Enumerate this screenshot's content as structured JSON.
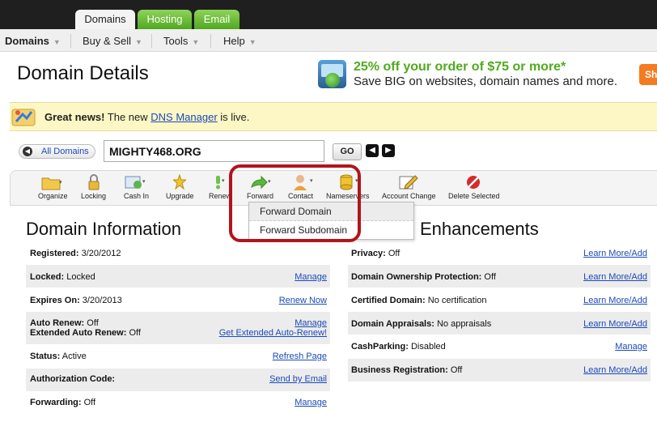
{
  "tabs": [
    {
      "label": "Domains"
    },
    {
      "label": "Hosting"
    },
    {
      "label": "Email"
    }
  ],
  "menu": [
    {
      "label": "Domains"
    },
    {
      "label": "Buy & Sell"
    },
    {
      "label": "Tools"
    },
    {
      "label": "Help"
    }
  ],
  "page": {
    "title": "Domain Details"
  },
  "promo": {
    "line1": "25% off your order of $75 or more*",
    "line2": "Save BIG on websites, domain names and more.",
    "badge": "Sh"
  },
  "news": {
    "bold": "Great news!",
    "pre": " The new ",
    "link": "DNS Manager",
    "post": " is live."
  },
  "nav": {
    "all_domains": "All Domains",
    "domain_value": "MIGHTY468.ORG",
    "go": "GO"
  },
  "toolbar": [
    {
      "label": "Organize",
      "icon": "folder-icon"
    },
    {
      "label": "Locking",
      "icon": "lock-icon"
    },
    {
      "label": "Cash In",
      "icon": "cash-icon"
    },
    {
      "label": "Upgrade",
      "icon": "upgrade-icon"
    },
    {
      "label": "Renew",
      "icon": "renew-icon"
    },
    {
      "label": "Forward",
      "icon": "forward-arrow-icon"
    },
    {
      "label": "Contact",
      "icon": "contact-icon"
    },
    {
      "label": "Nameservers",
      "icon": "nameservers-icon"
    },
    {
      "label": "Account Change",
      "icon": "account-change-icon"
    },
    {
      "label": "Delete Selected",
      "icon": "delete-icon"
    }
  ],
  "forward_menu": [
    {
      "label": "Forward Domain"
    },
    {
      "label": "Forward Subdomain"
    }
  ],
  "domain_info": {
    "title": "Domain Information",
    "rows": [
      {
        "key": "Registered:",
        "value": " 3/20/2012",
        "link": ""
      },
      {
        "key": "Locked:",
        "value": " Locked",
        "link": "Manage"
      },
      {
        "key": "Expires On:",
        "value": " 3/20/2013",
        "link": "Renew Now"
      },
      {
        "key": "Auto Renew:",
        "value": " Off",
        "link": "Manage",
        "key2": "Extended Auto Renew:",
        "value2": " Off",
        "link2": "Get Extended Auto-Renew!"
      },
      {
        "key": "Status:",
        "value": " Active",
        "link": "Refresh Page"
      },
      {
        "key": "Authorization Code:",
        "value": "",
        "link": "Send by Email"
      },
      {
        "key": "Forwarding:",
        "value": " Off",
        "link": "Manage"
      }
    ]
  },
  "enhancements": {
    "title": "Enhancements",
    "rows": [
      {
        "key": "Privacy:",
        "value": " Off",
        "link": "Learn More/Add"
      },
      {
        "key": "Domain Ownership Protection:",
        "value": " Off",
        "link": "Learn More/Add"
      },
      {
        "key": "Certified Domain:",
        "value": " No certification",
        "link": "Learn More/Add"
      },
      {
        "key": "Domain Appraisals:",
        "value": " No appraisals",
        "link": "Learn More/Add"
      },
      {
        "key": "CashParking:",
        "value": " Disabled",
        "link": "Manage"
      },
      {
        "key": "Business Registration:",
        "value": " Off",
        "link": "Learn More/Add"
      }
    ]
  }
}
